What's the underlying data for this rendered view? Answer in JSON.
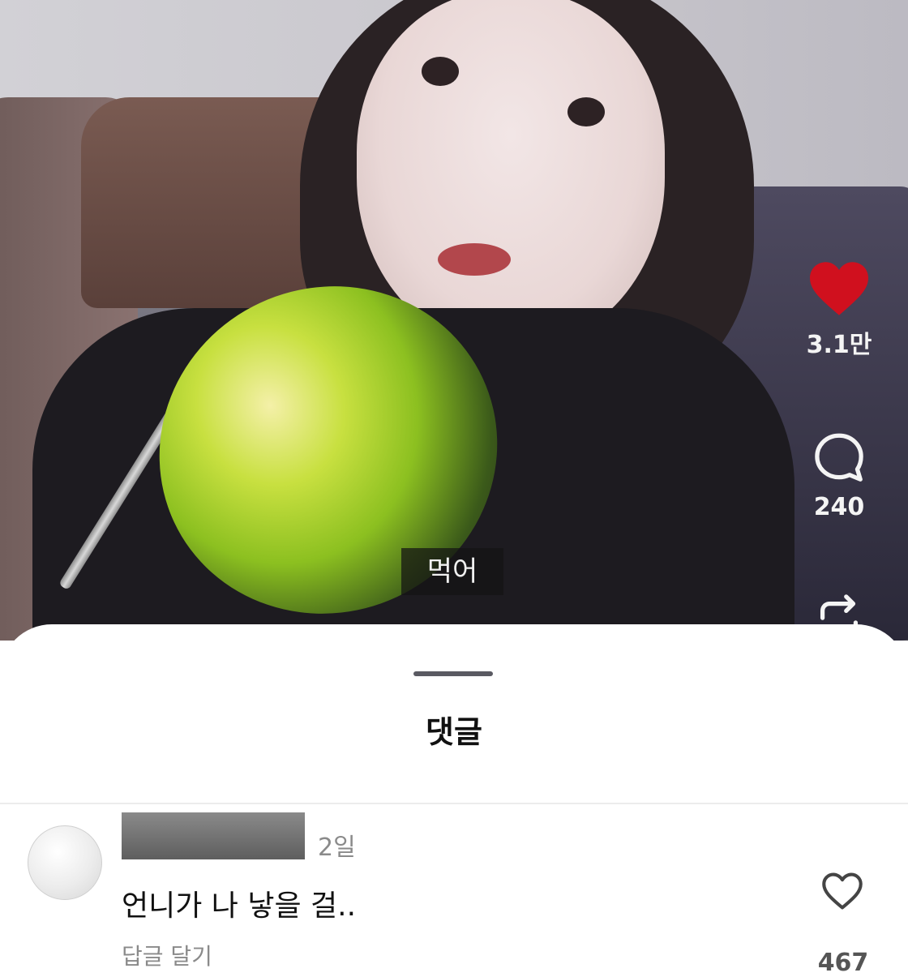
{
  "video": {
    "subtitle": "먹어",
    "actions": {
      "likes": "3.1만",
      "comments": "240",
      "like_color": "#d0101e"
    }
  },
  "comments_sheet": {
    "title": "댓글",
    "items": [
      {
        "time": "2일",
        "text": "언니가 나 낳을 걸..",
        "reply_label": "답글 달기",
        "likes": "467"
      }
    ]
  }
}
